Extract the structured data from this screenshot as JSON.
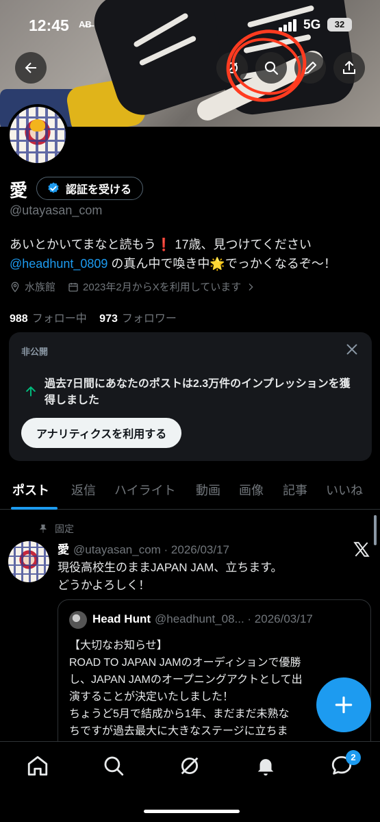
{
  "status": {
    "time": "12:45",
    "carrier": "A̶B̶",
    "network": "5G",
    "battery": "32"
  },
  "profile": {
    "name": "愛",
    "verify_label": "認証を受ける",
    "handle": "@utayasan_com",
    "bio_part1": "あいとかいてまなと読もう❗️ 17歳、見つけてください",
    "bio_mention": "@headhunt_0809",
    "bio_part2": "の真ん中で喚き中🌟でっかくなるぞ〜！",
    "location": "水族館",
    "joined": "2023年2月からXを利用しています",
    "following_count": "988",
    "following_label": "フォロー中",
    "followers_count": "973",
    "followers_label": "フォロワー"
  },
  "private_card": {
    "caption": "非公開",
    "message": "過去7日間にあなたのポストは2.3万件のインプレッションを獲得しました",
    "button": "アナリティクスを利用する"
  },
  "tabs": [
    "ポスト",
    "返信",
    "ハイライト",
    "動画",
    "画像",
    "記事",
    "いいね"
  ],
  "post": {
    "pinned_label": "固定",
    "author": "愛",
    "meta": "@utayasan_com · 2026/03/17",
    "text_line1": "現役高校生のままJAPAN JAM、立ちます。",
    "text_line2": "どうかよろしく！",
    "quote": {
      "author": "Head Hunt",
      "meta": "@headhunt_08... · 2026/03/17",
      "lines": [
        "【大切なお知らせ】",
        "ROAD TO JAPAN JAMのオーディションで優勝",
        "し、JAPAN JAMのオープニングアクトとして出",
        "演することが決定いたしました！",
        "ちょうど5月で結成から1年、まだまだ未熟な",
        "ちですが過去最大に大きなステージに立ちま"
      ]
    }
  },
  "nav": {
    "messages_badge": "2"
  },
  "colors": {
    "accent": "#1d9bf0",
    "annotation": "#ff3b20",
    "background": "#000000"
  }
}
